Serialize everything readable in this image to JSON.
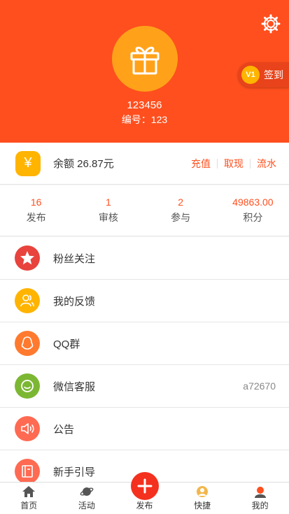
{
  "profile": {
    "username": "123456",
    "number": "编号：123",
    "level": "V1",
    "sign_in": "签到"
  },
  "balance": {
    "label": "余额 26.87元",
    "actions": [
      "充值",
      "取现",
      "流水"
    ]
  },
  "stats": [
    {
      "value": "16",
      "label": "发布"
    },
    {
      "value": "1",
      "label": "审核"
    },
    {
      "value": "2",
      "label": "参与"
    },
    {
      "value": "49863.00",
      "label": "积分"
    }
  ],
  "menu": [
    {
      "label": "粉丝关注",
      "value": "",
      "icon": "star-icon",
      "color": "#e8433d"
    },
    {
      "label": "我的反馈",
      "value": "",
      "icon": "users-icon",
      "color": "#ffb400"
    },
    {
      "label": "QQ群",
      "value": "",
      "icon": "qq-icon",
      "color": "#ff7a2e"
    },
    {
      "label": "微信客服",
      "value": "a72670",
      "icon": "wechat-icon",
      "color": "#7cb733"
    },
    {
      "label": "公告",
      "value": "",
      "icon": "speaker-icon",
      "color": "#ff6a52"
    },
    {
      "label": "新手引导",
      "value": "",
      "icon": "book-icon",
      "color": "#ff6a52"
    }
  ],
  "tabs": [
    {
      "label": "首页",
      "icon": "home-icon"
    },
    {
      "label": "活动",
      "icon": "planet-icon"
    },
    {
      "label": "发布",
      "icon": "plus-icon"
    },
    {
      "label": "快捷",
      "icon": "avatar-icon"
    },
    {
      "label": "我的",
      "icon": "user-icon"
    }
  ],
  "colors": {
    "primary": "#ff4f1e",
    "gold": "#ffb400"
  }
}
